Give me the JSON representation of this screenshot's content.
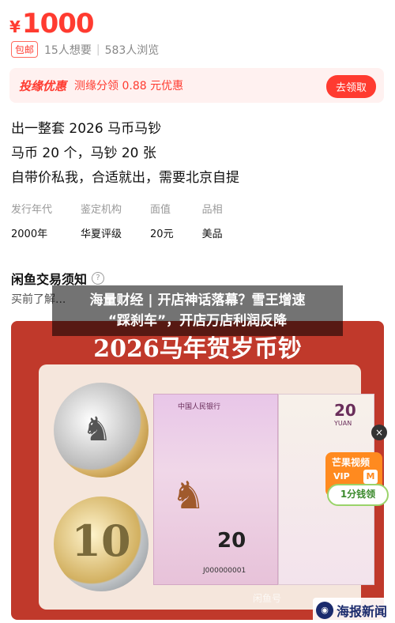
{
  "price": {
    "currency": "¥",
    "amount": "1000"
  },
  "meta": {
    "tag": "包邮",
    "wants": "15人想要",
    "views": "583人浏览"
  },
  "coupon": {
    "brand": "投缘优惠",
    "desc": "测缘分领 0.88 元优惠",
    "button": "去领取"
  },
  "description": [
    "出一整套 2026 马币马钞",
    "马币 20 个，马钞 20 张",
    "自带价私我，合适就出，需要北京自提"
  ],
  "attributes": [
    {
      "key": "发行年代",
      "value": "2000年"
    },
    {
      "key": "鉴定机构",
      "value": "华夏评级"
    },
    {
      "key": "面值",
      "value": "20元"
    },
    {
      "key": "品相",
      "value": "美品"
    }
  ],
  "notice": {
    "title": "闲鱼交易须知",
    "text": "买前了解..."
  },
  "overlay": {
    "line1": "海量财经 | 开店神话落幕？雪王增速",
    "line2": "“踩刹车”，开店万店利润反降"
  },
  "photo": {
    "title": "2026马年贺岁币钞",
    "coin_value": "10",
    "note_value": "20",
    "note_header": "中国人民银行",
    "note_serial": "J000000001",
    "note2_value": "20",
    "note2_unit": "YUAN"
  },
  "ads": {
    "close": "×",
    "mango_title": "芒果视频",
    "mango_vip": "VIP",
    "mango_badge": "M",
    "reward": "1分钱领"
  },
  "watermark": "闲鱼号",
  "logo": "海报新闻"
}
